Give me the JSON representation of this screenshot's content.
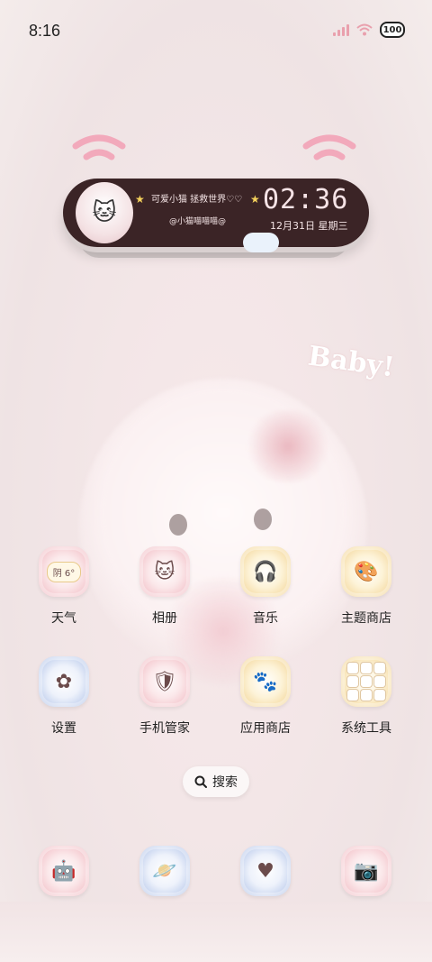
{
  "status_bar": {
    "time": "8:16",
    "battery": "100"
  },
  "widget": {
    "line1": "可爱小猫 拯救世界♡♡",
    "line2": "@小猫喵喵喵@",
    "time": "02:36",
    "date": "12月31日 星期三"
  },
  "wallpaper": {
    "baby_text": "Baby!"
  },
  "apps": [
    {
      "label": "天气",
      "badge": "阴 6°",
      "icon": "weather-icon",
      "color": "pink"
    },
    {
      "label": "相册",
      "icon": "gallery-cat-icon",
      "color": "pink"
    },
    {
      "label": "音乐",
      "icon": "music-cat-icon",
      "color": "yellow"
    },
    {
      "label": "主题商店",
      "icon": "theme-store-icon",
      "color": "yellow"
    },
    {
      "label": "设置",
      "icon": "settings-flower-icon",
      "color": "blue"
    },
    {
      "label": "手机管家",
      "icon": "phone-manager-icon",
      "color": "pink"
    },
    {
      "label": "应用商店",
      "icon": "app-store-icon",
      "color": "yellow"
    },
    {
      "label": "系统工具",
      "icon": "system-tools-folder-icon",
      "color": "yellow"
    }
  ],
  "search": {
    "label": "搜索"
  },
  "dock": [
    {
      "icon": "phone-robot-icon",
      "color": "pink"
    },
    {
      "icon": "messages-planet-icon",
      "color": "blue"
    },
    {
      "icon": "browser-cat-icon",
      "color": "blue"
    },
    {
      "icon": "camera-toast-icon",
      "color": "pink"
    }
  ]
}
